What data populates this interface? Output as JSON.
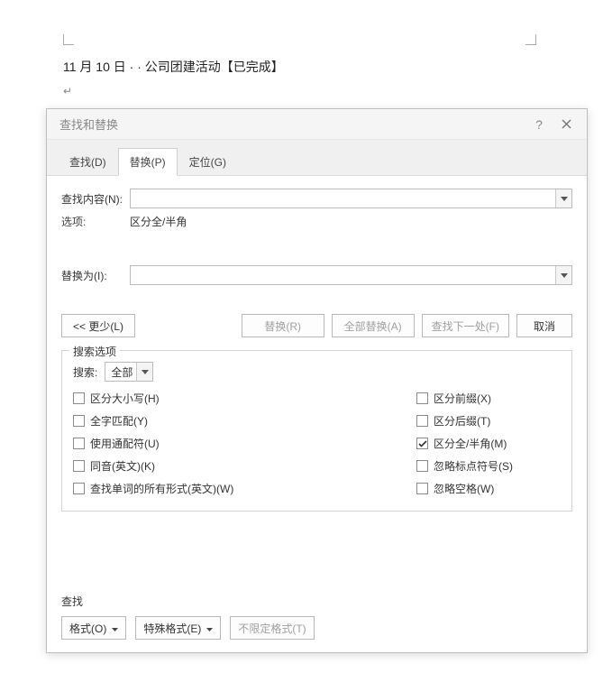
{
  "document": {
    "line": "11 月 10 日 · · 公司团建活动【已完成】"
  },
  "dialog": {
    "title": "查找和替换",
    "tabs": {
      "find": "查找(D)",
      "replace": "替换(P)",
      "goto": "定位(G)"
    },
    "fields": {
      "find_label": "查找内容(N):",
      "find_value": "",
      "options_label": "选项:",
      "options_value": "区分全/半角",
      "replace_label": "替换为(I):",
      "replace_value": ""
    },
    "buttons": {
      "less": "<< 更少(L)",
      "replace": "替换(R)",
      "replace_all": "全部替换(A)",
      "find_next": "查找下一处(F)",
      "cancel": "取消"
    },
    "search_options": {
      "legend": "搜索选项",
      "direction_label": "搜索:",
      "direction_value": "全部",
      "left": [
        {
          "label": "区分大小写(H)",
          "checked": false
        },
        {
          "label": "全字匹配(Y)",
          "checked": false
        },
        {
          "label": "使用通配符(U)",
          "checked": false
        },
        {
          "label": "同音(英文)(K)",
          "checked": false
        },
        {
          "label": "查找单词的所有形式(英文)(W)",
          "checked": false
        }
      ],
      "right": [
        {
          "label": "区分前缀(X)",
          "checked": false
        },
        {
          "label": "区分后缀(T)",
          "checked": false
        },
        {
          "label": "区分全/半角(M)",
          "checked": true
        },
        {
          "label": "忽略标点符号(S)",
          "checked": false
        },
        {
          "label": "忽略空格(W)",
          "checked": false
        }
      ]
    },
    "find_section": {
      "label": "查找",
      "format_btn": "格式(O)",
      "special_btn": "特殊格式(E)",
      "no_format_btn": "不限定格式(T)"
    }
  }
}
